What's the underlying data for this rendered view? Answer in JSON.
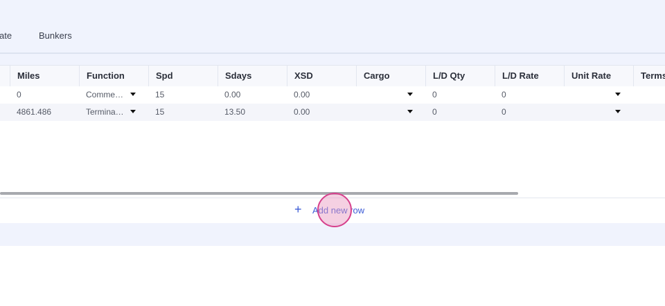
{
  "tabs": {
    "partial_label": "ate",
    "bunkers_label": "Bunkers"
  },
  "table": {
    "headers": {
      "miles": "Miles",
      "function": "Function",
      "spd": "Spd",
      "sdays": "Sdays",
      "xsd": "XSD",
      "cargo": "Cargo",
      "ld_qty": "L/D Qty",
      "ld_rate": "L/D Rate",
      "unit_rate": "Unit Rate",
      "terms": "Terms"
    },
    "rows": [
      {
        "miles": "0",
        "function": "Comme…",
        "spd": "15",
        "sdays": "0.00",
        "xsd": "0.00",
        "cargo": "",
        "ld_qty": "0",
        "ld_rate": "0",
        "unit_rate": "",
        "terms": ""
      },
      {
        "miles": "4861.486",
        "function": "Termina…",
        "spd": "15",
        "sdays": "13.50",
        "xsd": "0.00",
        "cargo": "",
        "ld_qty": "0",
        "ld_rate": "0",
        "unit_rate": "",
        "terms": ""
      }
    ]
  },
  "actions": {
    "add_row_label": "Add new row",
    "plus_icon": "plus-icon"
  },
  "colors": {
    "accent": "#3b5bd6",
    "header_band": "#f0f3fd"
  }
}
